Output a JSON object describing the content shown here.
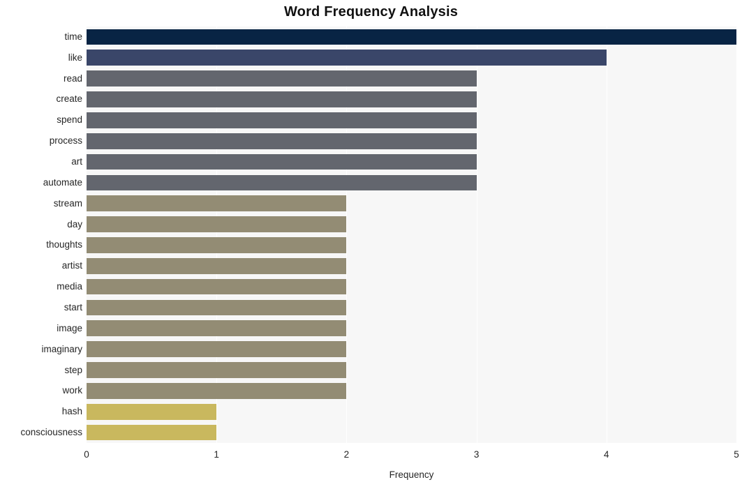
{
  "chart_data": {
    "type": "bar",
    "orientation": "horizontal",
    "title": "Word Frequency Analysis",
    "xlabel": "Frequency",
    "ylabel": "",
    "xlim": [
      0,
      5
    ],
    "xticks": [
      "0",
      "1",
      "2",
      "3",
      "4",
      "5"
    ],
    "xtick_values": [
      0,
      1,
      2,
      3,
      4,
      5
    ],
    "grid": "vertical-white",
    "legend": "none",
    "categories": [
      "time",
      "like",
      "read",
      "create",
      "spend",
      "process",
      "art",
      "automate",
      "stream",
      "day",
      "thoughts",
      "artist",
      "media",
      "start",
      "image",
      "imaginary",
      "step",
      "work",
      "hash",
      "consciousness"
    ],
    "values": [
      5,
      4,
      3,
      3,
      3,
      3,
      3,
      3,
      2,
      2,
      2,
      2,
      2,
      2,
      2,
      2,
      2,
      2,
      1,
      1
    ],
    "bar_colors": [
      "#082444",
      "#3a4669",
      "#63666e",
      "#63666e",
      "#63666e",
      "#63666e",
      "#63666e",
      "#63666e",
      "#938c74",
      "#938c74",
      "#938c74",
      "#938c74",
      "#938c74",
      "#938c74",
      "#938c74",
      "#938c74",
      "#938c74",
      "#938c74",
      "#c9b85e",
      "#c9b85e"
    ]
  },
  "colors": {
    "page_background": "#ffffff",
    "plot_background": "#f7f7f7",
    "gridline": "#ffffff",
    "title_text": "#111111",
    "tick_text": "#262626"
  }
}
